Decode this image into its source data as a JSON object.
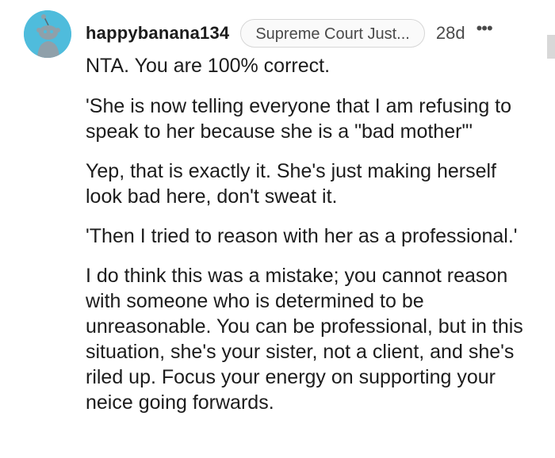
{
  "comment": {
    "author": "happybanana134",
    "flair": "Supreme Court Just...",
    "age": "28d",
    "more_label": "•••",
    "avatar_icon": "snoo-avatar-icon",
    "colors": {
      "avatar_bg": "#4fbcdc",
      "text": "#1c1c1c",
      "meta": "#4a4a4a"
    },
    "paragraphs": [
      "NTA. You are 100% correct.",
      "'She is now telling everyone that I am refusing to speak to her because she is a \"bad mother\"'",
      "Yep, that is exactly it. She's just making herself look bad here, don't sweat it.",
      "'Then I tried to reason with her as a professional.'",
      "I do think this was a mistake; you cannot reason with someone who is determined to be unreasonable. You can be professional, but in this situation, she's your sister, not a client, and she's riled up. Focus your energy on supporting your neice going forwards."
    ]
  }
}
